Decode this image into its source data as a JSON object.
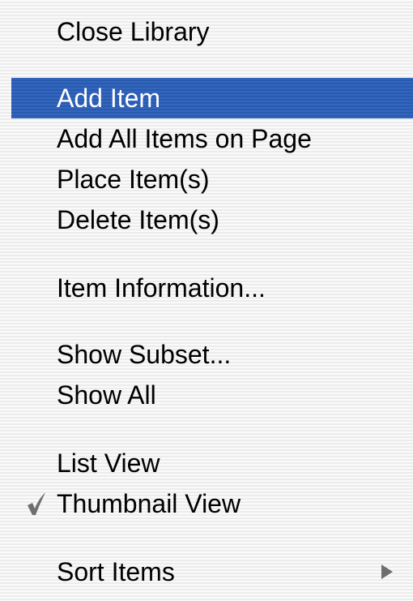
{
  "menu": {
    "items": [
      {
        "label": "Close Library"
      },
      {
        "label": "Add Item",
        "highlighted": true
      },
      {
        "label": "Add All Items on Page"
      },
      {
        "label": "Place Item(s)"
      },
      {
        "label": "Delete Item(s)"
      },
      {
        "label": "Item Information..."
      },
      {
        "label": "Show Subset..."
      },
      {
        "label": "Show All"
      },
      {
        "label": "List View"
      },
      {
        "label": "Thumbnail View",
        "checked": true,
        "check_icon": "checkmark-icon"
      },
      {
        "label": "Sort Items",
        "submenu": true,
        "submenu_icon": "submenu-arrow-icon"
      }
    ]
  },
  "colors": {
    "highlight": "#2c5fb6",
    "highlight_text": "#ffffff",
    "text": "#000000",
    "icon_gray": "#6e6e6e"
  }
}
